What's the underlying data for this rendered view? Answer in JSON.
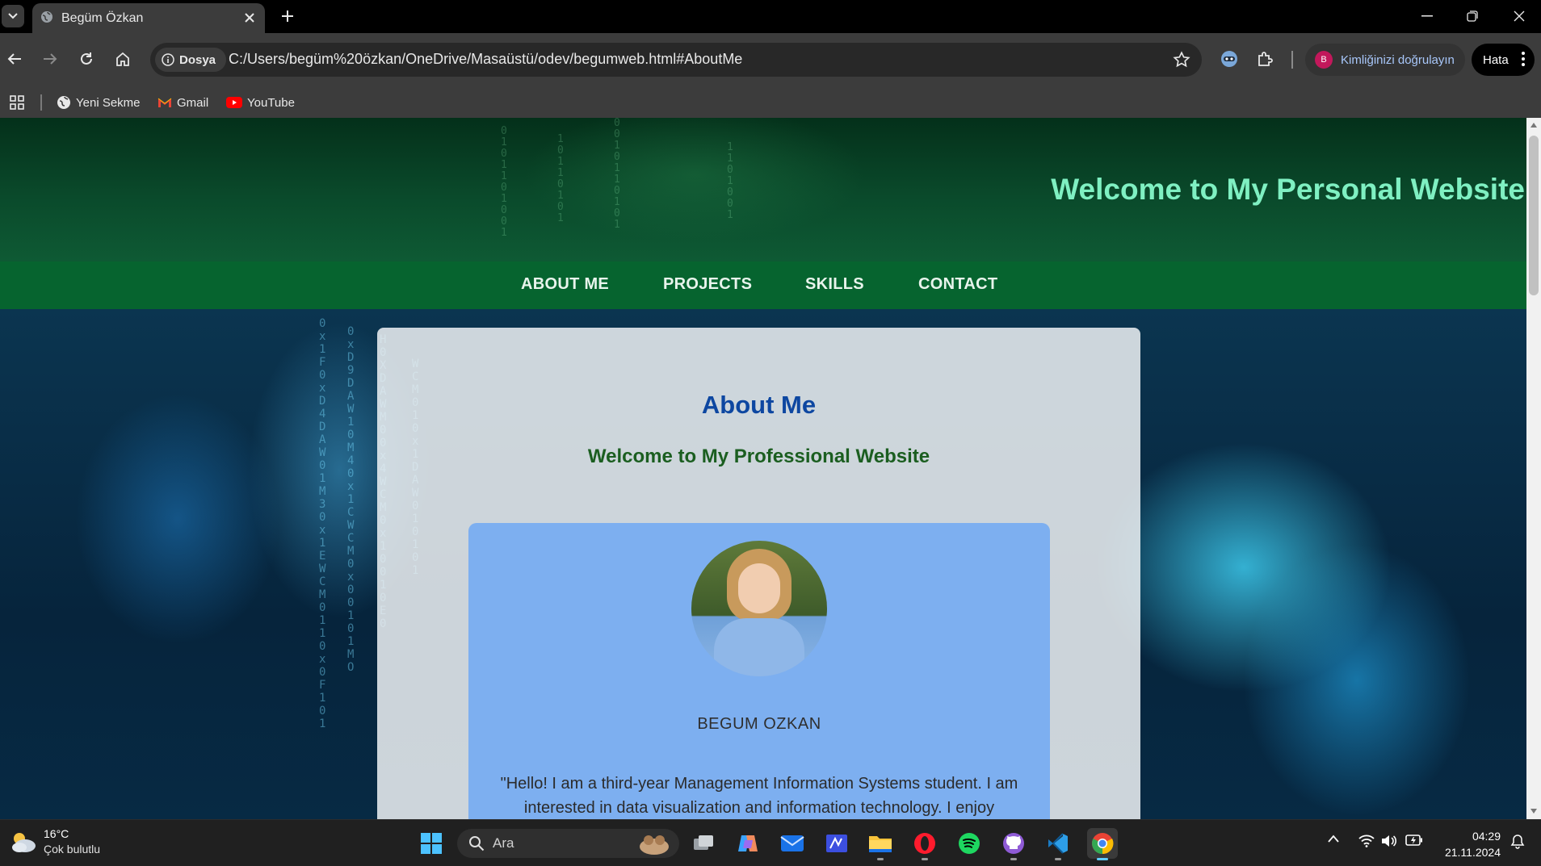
{
  "browser": {
    "tab_title": "Begüm Özkan",
    "site_chip_label": "Dosya",
    "url": "C:/Users/begüm%20özkan/OneDrive/Masaüstü/odev/begumweb.html#AboutMe",
    "profile_initial": "B",
    "verify_label": "Kimliğinizi doğrulayın",
    "error_label": "Hata",
    "bookmarks": [
      {
        "label": "Yeni Sekme"
      },
      {
        "label": "Gmail"
      },
      {
        "label": "YouTube"
      }
    ]
  },
  "page": {
    "site_title": "Welcome to My Personal Website",
    "nav": [
      "ABOUT ME",
      "PROJECTS",
      "SKILLS",
      "CONTACT"
    ],
    "section_title": "About Me",
    "section_subtitle": "Welcome to My Professional Website",
    "profile_name": "BEGUM OZKAN",
    "bio": "\"Hello! I am a third-year Management Information Systems student. I am interested in data visualization and information technology. I enjoy",
    "colors": {
      "header_title": "#7ff0c2",
      "nav_bg": "#06642f",
      "section_title": "#0d47a1",
      "subtitle": "#1b5e20",
      "profile_card": "#7daff0"
    }
  },
  "taskbar": {
    "weather_temp": "16°C",
    "weather_desc": "Çok bulutlu",
    "search_placeholder": "Ara",
    "time": "04:29",
    "date": "21.11.2024",
    "apps": [
      "task-view",
      "copilot",
      "mail",
      "visual-studio",
      "file-explorer",
      "opera",
      "spotify",
      "github-desktop",
      "vscode",
      "chrome"
    ]
  }
}
